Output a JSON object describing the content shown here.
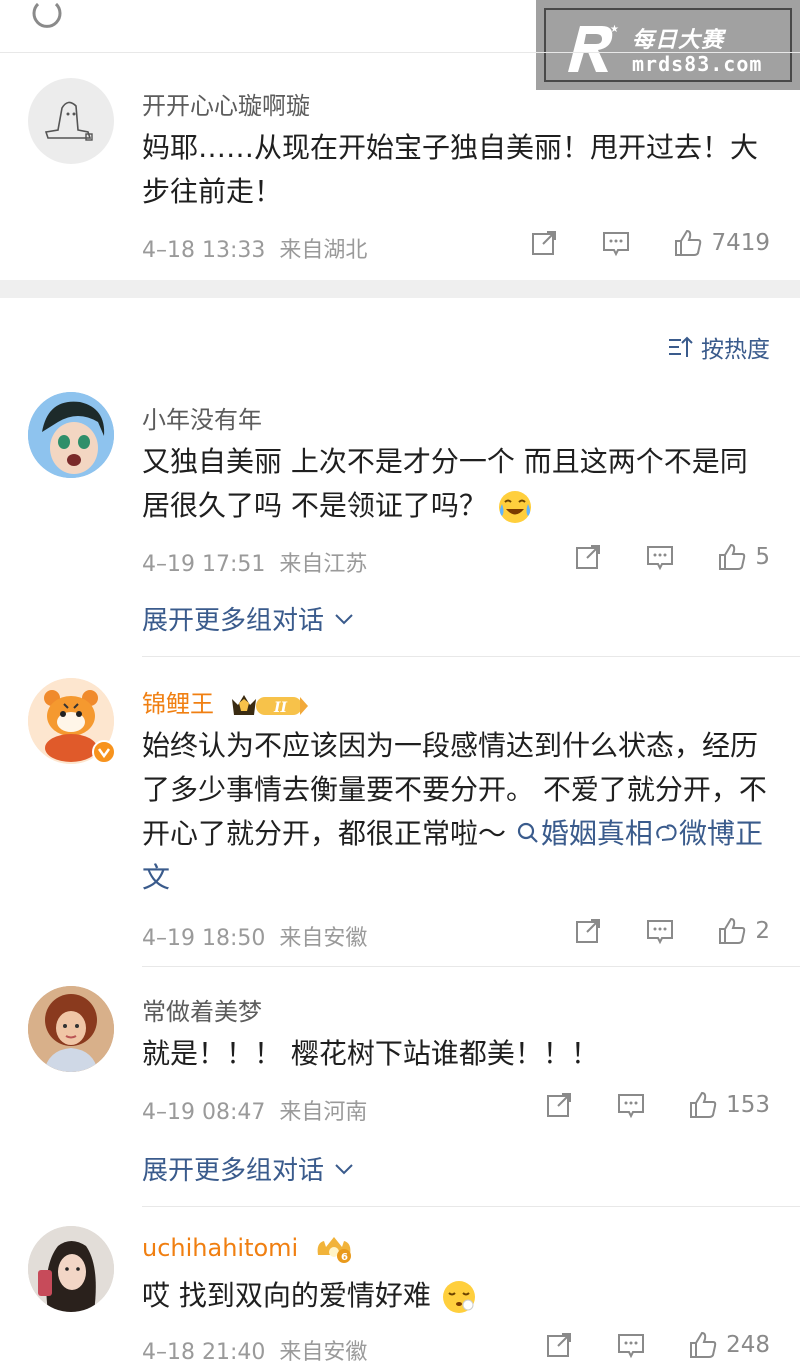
{
  "watermark": {
    "line1": "每日大赛",
    "line2": "mrds83.com"
  },
  "sort": {
    "label": "按热度"
  },
  "comments": [
    {
      "name": "开开心心璇啊璇",
      "text": "妈耶……从现在开始宝子独自美丽！甩开过去！大步往前走！",
      "time": "4–18 13:33",
      "location": "来自湖北",
      "likes": "7419"
    },
    {
      "name": "小年没有年",
      "text": "又独自美丽 上次不是才分一个 而且这两个不是同居很久了吗 不是领证了吗？",
      "time": "4–19 17:51",
      "location": "来自江苏",
      "likes": "5",
      "expand": "展开更多组对话"
    },
    {
      "name": "锦鲤王",
      "badge": "II",
      "text": "始终认为不应该因为一段感情达到什么状态，经历了多少事情去衡量要不要分开。 不爱了就分开，不开心了就分开，都很正常啦～",
      "link1": "婚姻真相",
      "link2": "微博正文",
      "time": "4–19 18:50",
      "location": "来自安徽",
      "likes": "2"
    },
    {
      "name": "常做着美梦",
      "text": "就是！！！ 樱花树下站谁都美！！！",
      "time": "4–19 08:47",
      "location": "来自河南",
      "likes": "153",
      "expand": "展开更多组对话"
    },
    {
      "name": "uchihahitomi",
      "badge": "6",
      "text": "哎 找到双向的爱情好难",
      "time": "4–18 21:40",
      "location": "来自安徽",
      "likes": "248"
    }
  ]
}
